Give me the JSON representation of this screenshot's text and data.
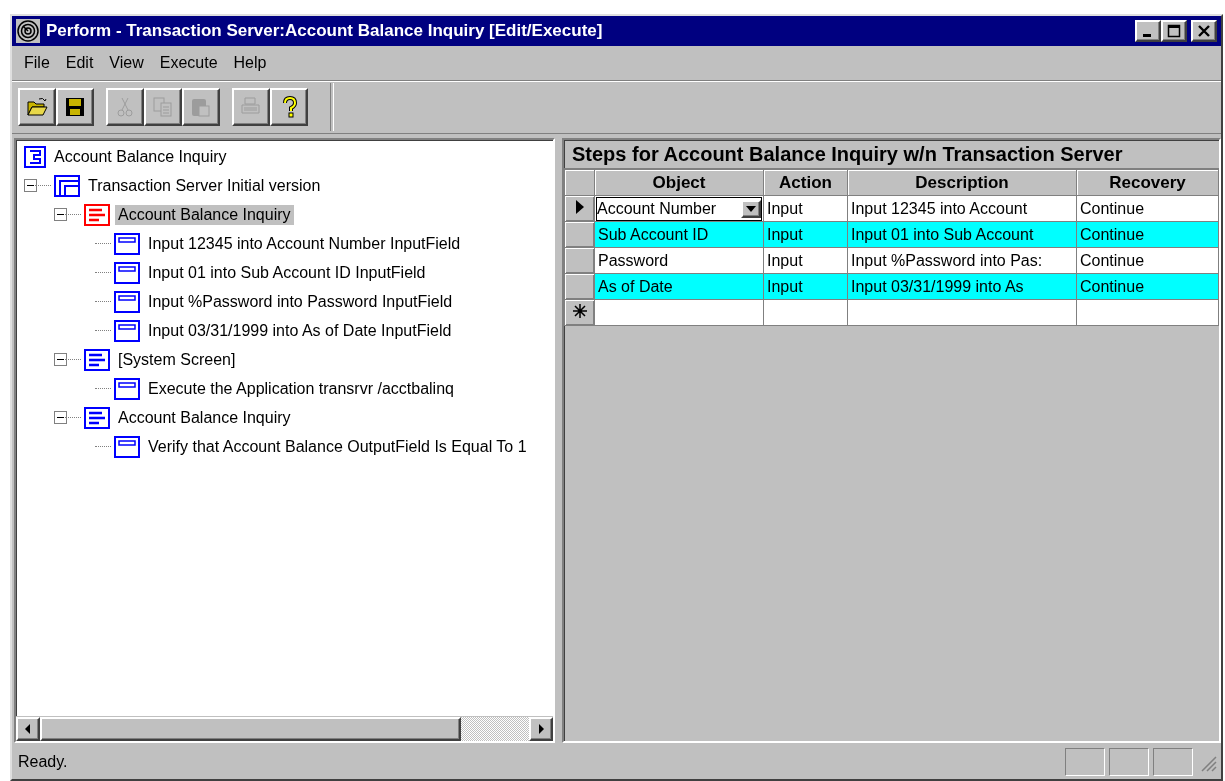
{
  "window": {
    "title": "Perform - Transaction Server:Account Balance Inquiry [Edit/Execute]"
  },
  "menu": [
    {
      "label": "File"
    },
    {
      "label": "Edit"
    },
    {
      "label": "View"
    },
    {
      "label": "Execute"
    },
    {
      "label": "Help"
    }
  ],
  "toolbar": [
    [
      {
        "kind": "open",
        "disabled": false
      },
      {
        "kind": "save",
        "disabled": false
      }
    ],
    [
      {
        "kind": "cut",
        "disabled": true
      },
      {
        "kind": "copy",
        "disabled": true
      },
      {
        "kind": "paste",
        "disabled": true
      }
    ],
    [
      {
        "kind": "print",
        "disabled": true
      },
      {
        "kind": "help",
        "disabled": false
      }
    ]
  ],
  "tree": [
    {
      "label": "Account Balance Inquiry",
      "kind": "suite",
      "selected": false,
      "children": [
        {
          "label": "Transaction Server Initial version",
          "kind": "version",
          "selected": false,
          "expanded": true,
          "children": [
            {
              "label": "Account Balance Inquiry",
              "kind": "screen",
              "color": "#ff0000",
              "selected": true,
              "expanded": true,
              "children": [
                {
                  "label": "Input 12345 into Account Number InputField",
                  "kind": "step",
                  "selected": false
                },
                {
                  "label": "Input 01 into Sub Account ID InputField",
                  "kind": "step",
                  "selected": false
                },
                {
                  "label": "Input %Password into Password InputField",
                  "kind": "step",
                  "selected": false
                },
                {
                  "label": "Input 03/31/1999 into As of Date InputField",
                  "kind": "step",
                  "selected": false
                }
              ]
            },
            {
              "label": "[System Screen]",
              "kind": "screen",
              "color": "#0000ff",
              "selected": false,
              "expanded": true,
              "children": [
                {
                  "label": "Execute the Application transrvr /acctbalinq",
                  "kind": "step",
                  "selected": false
                }
              ]
            },
            {
              "label": "Account Balance Inquiry",
              "kind": "screen",
              "color": "#0000ff",
              "selected": false,
              "expanded": true,
              "children": [
                {
                  "label": "Verify that Account Balance OutputField Is Equal To 1",
                  "kind": "step",
                  "selected": false
                }
              ]
            }
          ]
        }
      ]
    }
  ],
  "grid": {
    "title": "Steps for Account Balance Inquiry w/n Transaction Server",
    "columns": [
      "Object",
      "Action",
      "Description",
      "Recovery"
    ],
    "rows": [
      {
        "cells": [
          "Account Number",
          "Input",
          "Input 12345 into Account",
          "Continue"
        ],
        "current": true,
        "highlighted": false
      },
      {
        "cells": [
          "Sub Account ID",
          "Input",
          "Input 01 into Sub Account",
          "Continue"
        ],
        "current": false,
        "highlighted": true
      },
      {
        "cells": [
          "Password",
          "Input",
          "Input %Password into Pas:",
          "Continue"
        ],
        "current": false,
        "highlighted": false
      },
      {
        "cells": [
          "As of Date",
          "Input",
          "Input 03/31/1999 into As",
          "Continue"
        ],
        "current": false,
        "highlighted": true
      }
    ],
    "new_row": true
  },
  "status_bar": {
    "text": "Ready."
  }
}
